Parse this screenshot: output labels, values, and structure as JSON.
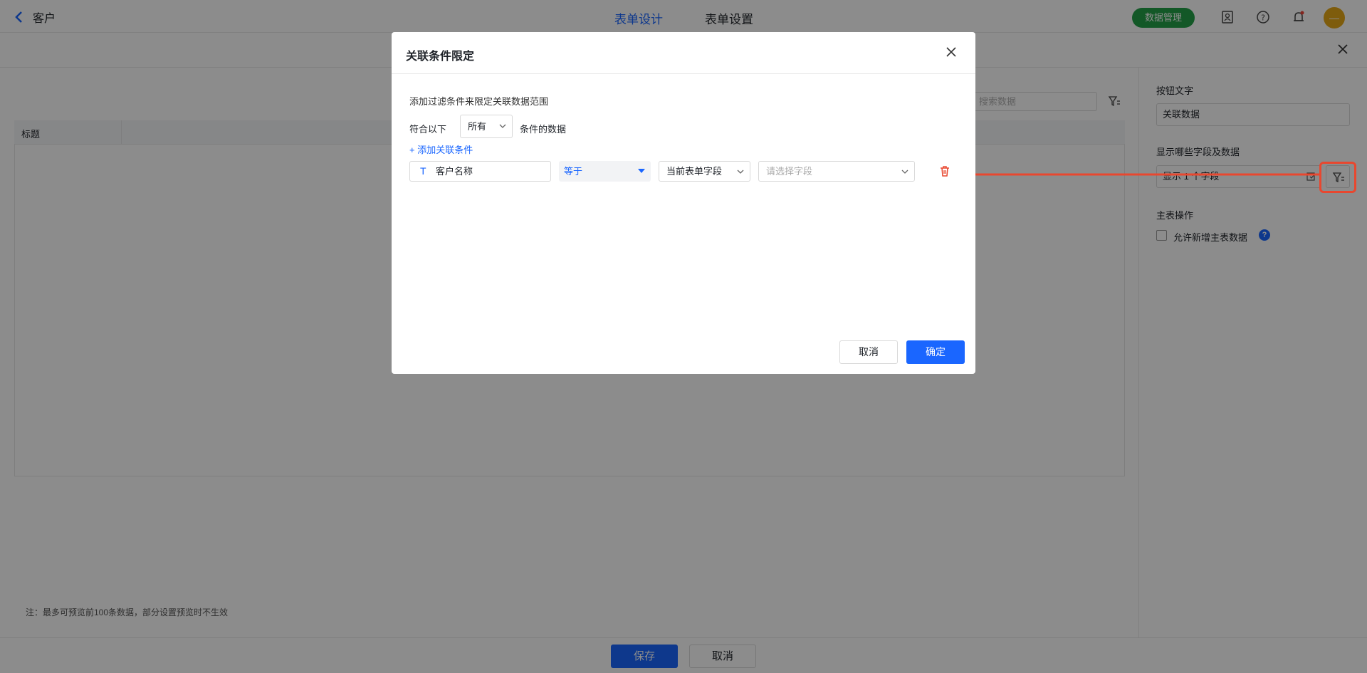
{
  "header": {
    "back_label": "客户",
    "tabs": [
      {
        "label": "表单设计",
        "active": true
      },
      {
        "label": "表单设置",
        "active": false
      }
    ],
    "data_manage_label": "数据管理",
    "avatar_text": "—"
  },
  "preview": {
    "search_placeholder": "搜索数据",
    "column_title": "标题",
    "note": "注：最多可预览前100条数据，部分设置预览时不生效"
  },
  "right_panel": {
    "button_text_label": "按钮文字",
    "button_text_value": "关联数据",
    "display_fields_label": "显示哪些字段及数据",
    "display_fields_value": "显示 1 个字段",
    "main_op_label": "主表操作",
    "allow_add_label": "允许新增主表数据",
    "help_symbol": "?"
  },
  "footer": {
    "save_label": "保存",
    "cancel_label": "取消"
  },
  "modal": {
    "title": "关联条件限定",
    "description": "添加过滤条件来限定关联数据范围",
    "match_prefix": "符合以下",
    "match_mode": "所有",
    "match_suffix": "条件的数据",
    "add_condition_label": "+ 添加关联条件",
    "condition": {
      "field_icon": "T",
      "field": "客户名称",
      "operator": "等于",
      "value_type": "当前表单字段",
      "value_placeholder": "请选择字段"
    },
    "cancel_label": "取消",
    "ok_label": "确定"
  },
  "colors": {
    "accent": "#1a66ff",
    "highlight": "#e8472f",
    "pill": "#24a148"
  }
}
